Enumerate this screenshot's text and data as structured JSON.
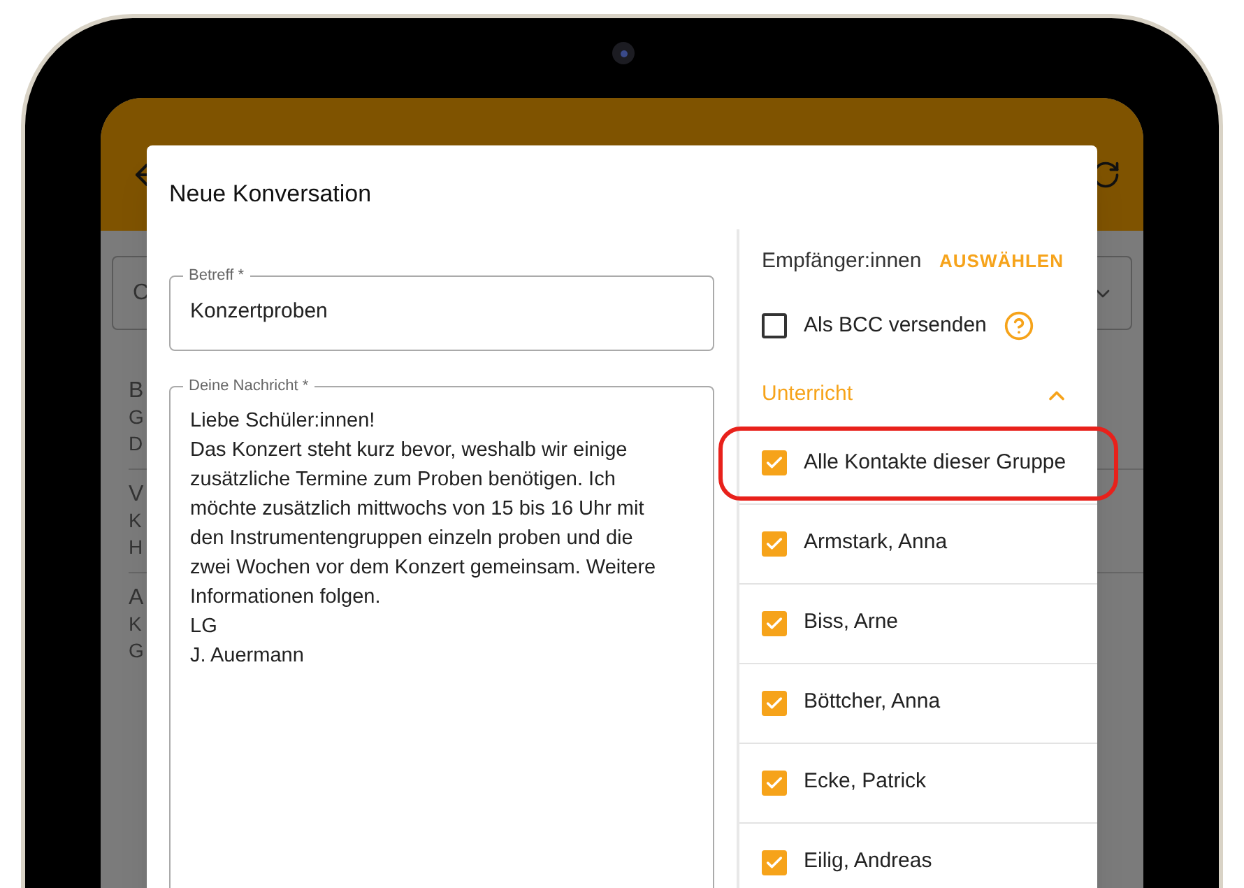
{
  "device": {
    "kind": "tablet"
  },
  "background": {
    "search_field": {
      "value": "C"
    },
    "list": [
      {
        "lines": [
          "B",
          "G",
          "D"
        ]
      },
      {
        "lines": [
          "V",
          "K",
          "H"
        ]
      },
      {
        "lines": [
          "A",
          "K",
          "G"
        ]
      }
    ]
  },
  "dialog": {
    "title": "Neue Konversation",
    "subject": {
      "label": "Betreff *",
      "value": "Konzertproben"
    },
    "message": {
      "label": "Deine Nachricht *",
      "lines": [
        "Liebe Schüler:innen!",
        "Das Konzert steht kurz bevor, weshalb wir einige",
        "zusätzliche Termine zum Proben benötigen. Ich",
        "möchte zusätzlich mittwochs von 15 bis 16 Uhr mit",
        "den Instrumentengruppen einzeln proben und die",
        "zwei Wochen vor dem Konzert gemeinsam. Weitere",
        "Informationen folgen.",
        "LG",
        "J. Auermann"
      ]
    },
    "recipients": {
      "label": "Empfänger:innen",
      "select_button": "AUSWÄHLEN",
      "bcc": {
        "label": "Als BCC versenden",
        "checked": false
      },
      "groups": [
        {
          "name": "Unterricht",
          "expanded": true,
          "items": [
            {
              "label": "Alle Kontakte dieser Gruppe",
              "checked": true,
              "highlighted": true
            },
            {
              "label": "Armstark, Anna",
              "checked": true,
              "highlighted": false
            },
            {
              "label": "Biss, Arne",
              "checked": true,
              "highlighted": false
            },
            {
              "label": "Böttcher, Anna",
              "checked": true,
              "highlighted": false
            },
            {
              "label": "Ecke, Patrick",
              "checked": true,
              "highlighted": false
            },
            {
              "label": "Eilig, Andreas",
              "checked": true,
              "highlighted": false
            }
          ]
        }
      ]
    }
  }
}
